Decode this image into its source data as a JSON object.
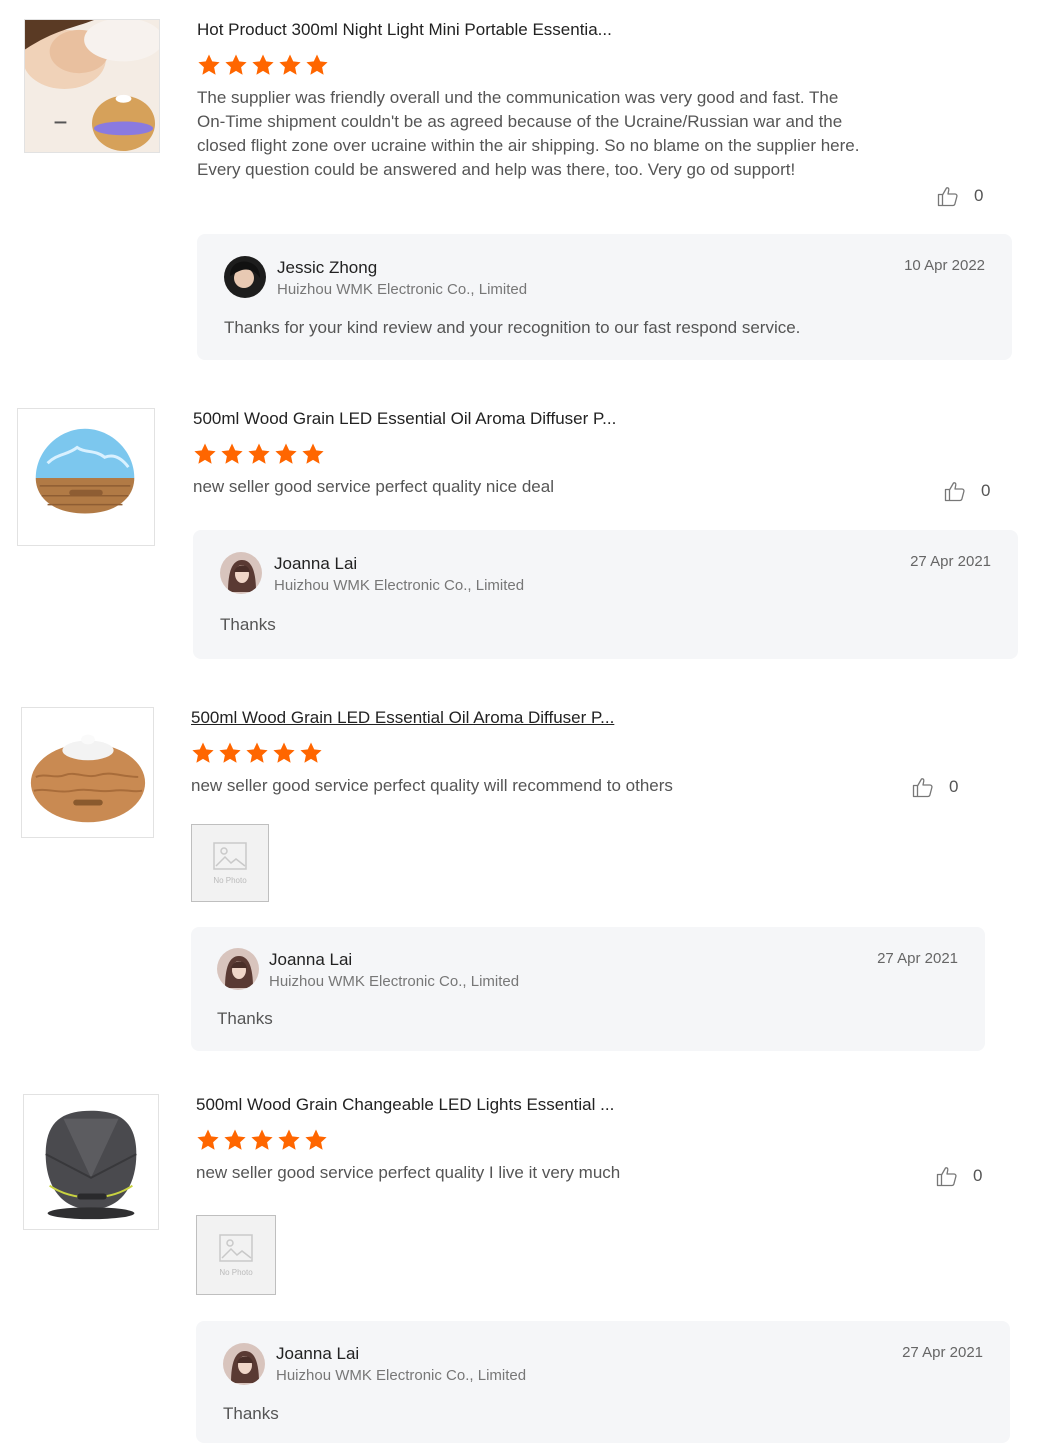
{
  "reviews": [
    {
      "product_title": "Hot Product 300ml Night Light Mini Portable Essentia...",
      "rating": 5,
      "text": "The supplier was friendly overall und the communication was very good and fast. The On-Time shipment couldn't be as agreed because of the Ucraine/Russian war and the closed flight zone over ucraine within the air shipping. So no blame on the supplier here. Every question could be answered and help was there, too. Very go od support!",
      "likes": "0",
      "reply": {
        "name": "Jessic Zhong",
        "company": "Huizhou WMK Electronic Co., Limited",
        "date": "10 Apr 2022",
        "text": "Thanks for your kind review and your recognition to our fast respond service."
      }
    },
    {
      "product_title": "500ml Wood Grain LED Essential Oil Aroma Diffuser P...",
      "rating": 5,
      "text": "new seller good service perfect quality nice deal",
      "likes": "0",
      "reply": {
        "name": "Joanna Lai",
        "company": "Huizhou WMK Electronic Co., Limited",
        "date": "27 Apr 2021",
        "text": "Thanks"
      }
    },
    {
      "product_title": "500ml Wood Grain LED Essential Oil Aroma Diffuser P...",
      "rating": 5,
      "text": "new seller good service perfect quality will recommend to others",
      "likes": "0",
      "photo_placeholder": "No Photo",
      "reply": {
        "name": "Joanna Lai",
        "company": "Huizhou WMK Electronic Co., Limited",
        "date": "27 Apr 2021",
        "text": "Thanks"
      }
    },
    {
      "product_title": "500ml Wood Grain Changeable LED Lights Essential ...",
      "rating": 5,
      "text": "new seller good service perfect quality I live it very much",
      "likes": "0",
      "photo_placeholder": "No Photo",
      "reply": {
        "name": "Joanna Lai",
        "company": "Huizhou WMK Electronic Co., Limited",
        "date": "27 Apr 2021",
        "text": "Thanks"
      }
    }
  ],
  "icons": {
    "star": "star-icon",
    "like": "thumbs-up-icon",
    "no_photo": "image-placeholder-icon"
  },
  "colors": {
    "star": "#ff6600",
    "reply_bg": "#f5f6f8"
  }
}
